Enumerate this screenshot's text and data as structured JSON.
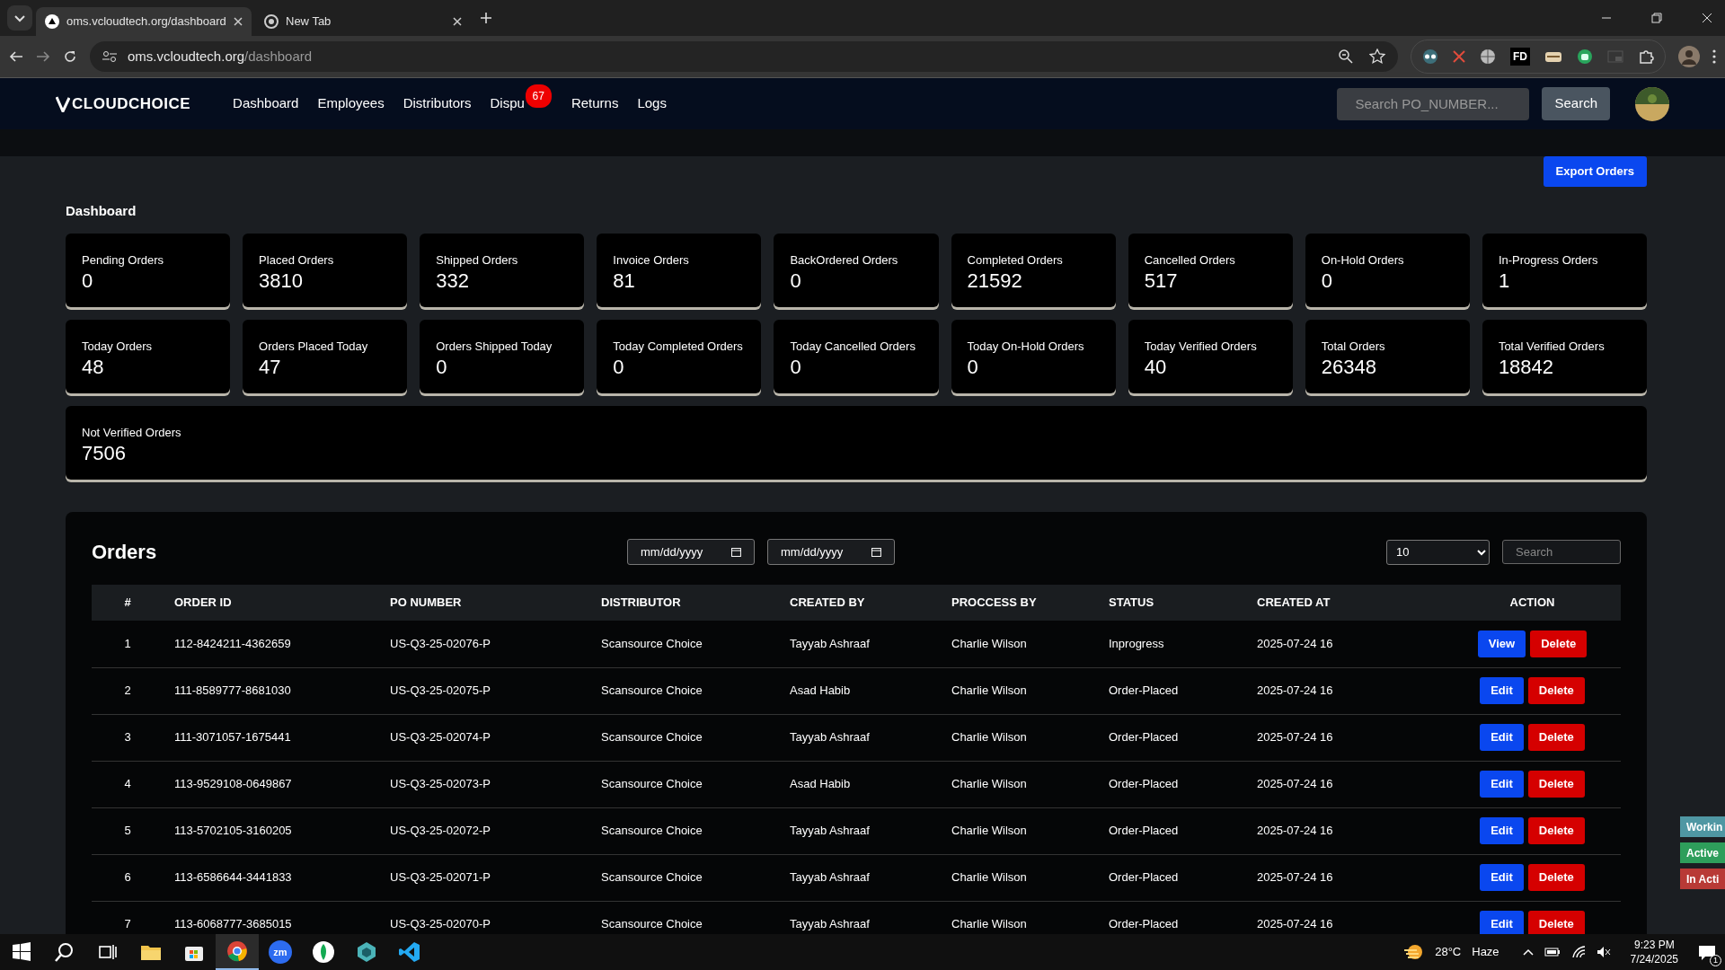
{
  "browser": {
    "tabs": [
      {
        "title": "oms.vcloudtech.org/dashboard",
        "selected": true
      },
      {
        "title": "New Tab",
        "selected": false
      }
    ],
    "url_host": "oms.vcloudtech.org",
    "url_path": "/dashboard",
    "extension_label": "FD"
  },
  "navbar": {
    "brand": "CLOUDCHOICE",
    "links": [
      {
        "label": "Dashboard"
      },
      {
        "label": "Employees"
      },
      {
        "label": "Distributors"
      },
      {
        "label": "Dispu",
        "badge": "67"
      },
      {
        "label": "Returns"
      },
      {
        "label": "Logs"
      }
    ],
    "search_placeholder": "Search PO_NUMBER...",
    "search_button": "Search"
  },
  "export_button": "Export Orders",
  "section_title": "Dashboard",
  "stats": [
    {
      "label": "Pending Orders",
      "value": "0",
      "kind": "card"
    },
    {
      "label": "Placed Orders",
      "value": "3810",
      "kind": "card"
    },
    {
      "label": "Shipped Orders",
      "value": "332",
      "kind": "card"
    },
    {
      "label": "Invoice Orders",
      "value": "81",
      "kind": "card"
    },
    {
      "label": "BackOrdered Orders",
      "value": "0",
      "kind": "card"
    },
    {
      "label": "Completed Orders",
      "value": "21592",
      "kind": "card"
    },
    {
      "label": "Cancelled Orders",
      "value": "517",
      "kind": "card"
    },
    {
      "label": "On-Hold Orders",
      "value": "0",
      "kind": "card"
    },
    {
      "label": "In-Progress Orders",
      "value": "1",
      "kind": "card"
    },
    {
      "label": "Today Orders",
      "value": "48",
      "kind": "card"
    },
    {
      "label": "Orders Placed Today",
      "value": "47",
      "kind": "card"
    },
    {
      "label": "Orders Shipped Today",
      "value": "0",
      "kind": "card"
    },
    {
      "label": "Today Completed Orders",
      "value": "0",
      "kind": "card"
    },
    {
      "label": "Today Cancelled Orders",
      "value": "0",
      "kind": "card"
    },
    {
      "label": "Today On-Hold Orders",
      "value": "0",
      "kind": "card"
    },
    {
      "label": "Today Verified Orders",
      "value": "40",
      "kind": "card"
    },
    {
      "label": "Total Orders",
      "value": "26348",
      "kind": "card"
    },
    {
      "label": "Total Verified Orders",
      "value": "18842",
      "kind": "card"
    },
    {
      "label": "Not Verified Orders",
      "value": "7506",
      "kind": "wide"
    }
  ],
  "orders": {
    "title": "Orders",
    "date_from": "mm/dd/yyyy",
    "date_to": "mm/dd/yyyy",
    "page_size": "10",
    "search_placeholder": "Search",
    "columns": [
      "#",
      "ORDER ID",
      "PO NUMBER",
      "DISTRIBUTOR",
      "CREATED BY",
      "PROCCESS BY",
      "STATUS",
      "CREATED AT",
      "ACTION"
    ],
    "rows": [
      {
        "cells": [
          "1",
          "112-8424211-4362659",
          "US-Q3-25-02076-P",
          "Scansource Choice",
          "Tayyab Ashraaf",
          "Charlie Wilson",
          "Inprogress",
          "2025-07-24 16"
        ],
        "actions": [
          {
            "label": "View",
            "kind": "view"
          },
          {
            "label": "Delete",
            "kind": "delete"
          }
        ]
      },
      {
        "cells": [
          "2",
          "111-8589777-8681030",
          "US-Q3-25-02075-P",
          "Scansource Choice",
          "Asad Habib",
          "Charlie Wilson",
          "Order-Placed",
          "2025-07-24 16"
        ],
        "actions": [
          {
            "label": "Edit",
            "kind": "edit"
          },
          {
            "label": "Delete",
            "kind": "delete"
          }
        ]
      },
      {
        "cells": [
          "3",
          "111-3071057-1675441",
          "US-Q3-25-02074-P",
          "Scansource Choice",
          "Tayyab Ashraaf",
          "Charlie Wilson",
          "Order-Placed",
          "2025-07-24 16"
        ],
        "actions": [
          {
            "label": "Edit",
            "kind": "edit"
          },
          {
            "label": "Delete",
            "kind": "delete"
          }
        ]
      },
      {
        "cells": [
          "4",
          "113-9529108-0649867",
          "US-Q3-25-02073-P",
          "Scansource Choice",
          "Asad Habib",
          "Charlie Wilson",
          "Order-Placed",
          "2025-07-24 16"
        ],
        "actions": [
          {
            "label": "Edit",
            "kind": "edit"
          },
          {
            "label": "Delete",
            "kind": "delete"
          }
        ]
      },
      {
        "cells": [
          "5",
          "113-5702105-3160205",
          "US-Q3-25-02072-P",
          "Scansource Choice",
          "Tayyab Ashraaf",
          "Charlie Wilson",
          "Order-Placed",
          "2025-07-24 16"
        ],
        "actions": [
          {
            "label": "Edit",
            "kind": "edit"
          },
          {
            "label": "Delete",
            "kind": "delete"
          }
        ]
      },
      {
        "cells": [
          "6",
          "113-6586644-3441833",
          "US-Q3-25-02071-P",
          "Scansource Choice",
          "Tayyab Ashraaf",
          "Charlie Wilson",
          "Order-Placed",
          "2025-07-24 16"
        ],
        "actions": [
          {
            "label": "Edit",
            "kind": "edit"
          },
          {
            "label": "Delete",
            "kind": "delete"
          }
        ]
      },
      {
        "cells": [
          "7",
          "113-6068777-3685015",
          "US-Q3-25-02070-P",
          "Scansource Choice",
          "Tayyab Ashraaf",
          "Charlie Wilson",
          "Order-Placed",
          "2025-07-24 16"
        ],
        "actions": [
          {
            "label": "Edit",
            "kind": "edit"
          },
          {
            "label": "Delete",
            "kind": "delete"
          }
        ]
      }
    ]
  },
  "status_tabs": [
    {
      "label": "Workin",
      "color": "#4f97a3"
    },
    {
      "label": "Active",
      "color": "#2e9e5b"
    },
    {
      "label": "In Acti",
      "color": "#b83a36"
    }
  ],
  "taskbar": {
    "zoom_label": "zm",
    "weather": "28°C",
    "condition": "Haze",
    "time": "9:23 PM",
    "date": "7/24/2025",
    "notifications": "1"
  }
}
